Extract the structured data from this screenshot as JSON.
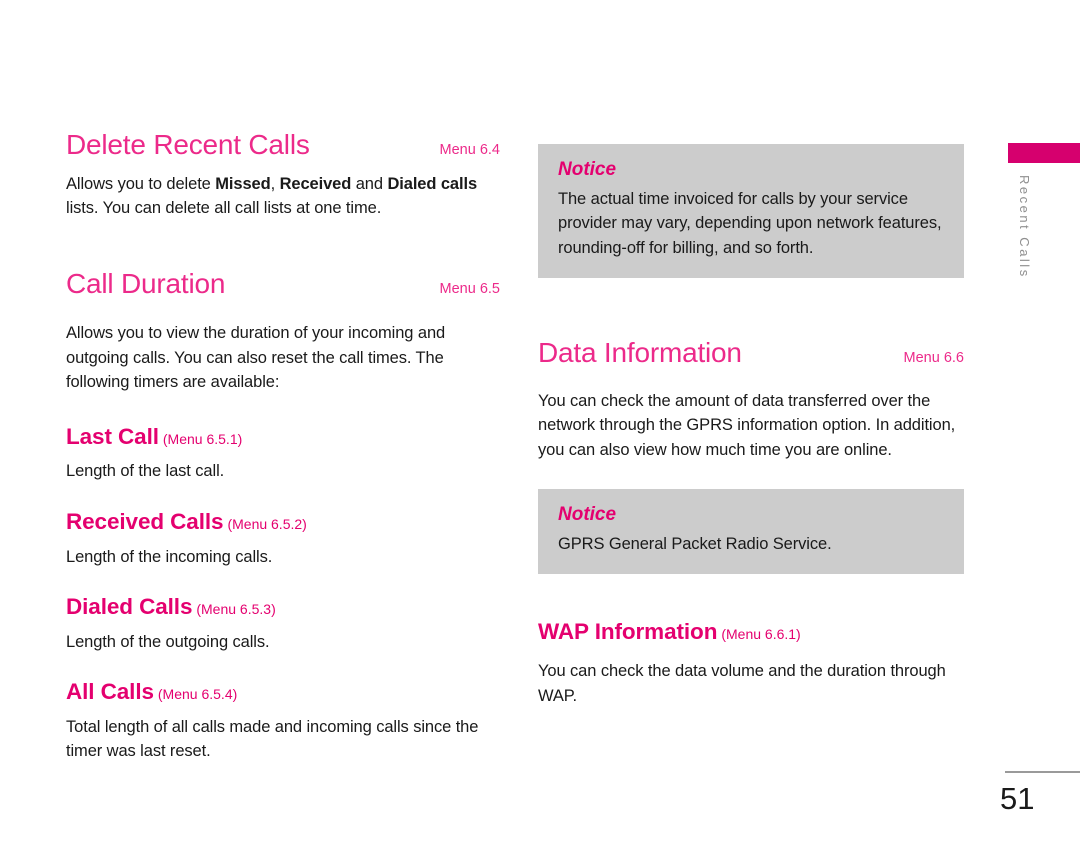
{
  "page": {
    "number": "51",
    "tab_label": "Recent Calls",
    "accent_heading": "#ec2a8a",
    "accent_subheading": "#e4006f",
    "tab_color": "#d6006e",
    "notice_bg": "#cccccc"
  },
  "left_column": {
    "sections": [
      {
        "title": "Delete Recent Calls",
        "menu": "Menu 6.4",
        "paragraph_parts": [
          {
            "text": "Allows you to delete ",
            "bold": false
          },
          {
            "text": "Missed",
            "bold": true
          },
          {
            "text": ", ",
            "bold": false
          },
          {
            "text": "Received",
            "bold": true
          },
          {
            "text": " and ",
            "bold": false
          },
          {
            "text": "Dialed calls",
            "bold": true
          },
          {
            "text": " lists. You can delete all call lists at one time.",
            "bold": false
          }
        ]
      },
      {
        "title": "Call Duration",
        "menu": "Menu 6.5",
        "paragraph": "Allows you to view the duration of your incoming and outgoing calls. You can also reset the call times. The following timers are available:"
      }
    ],
    "subsections": [
      {
        "title": "Last Call",
        "menu": "(Menu 6.5.1)",
        "body": "Length of the last call."
      },
      {
        "title": "Received Calls",
        "menu": "(Menu 6.5.2)",
        "body": "Length of the incoming calls."
      },
      {
        "title": "Dialed Calls",
        "menu": "(Menu 6.5.3)",
        "body": "Length of the outgoing calls."
      },
      {
        "title": "All Calls",
        "menu": "(Menu 6.5.4)",
        "body": "Total length of all calls made and incoming calls since the timer was last reset."
      }
    ]
  },
  "right_column": {
    "notice_top": {
      "title": "Notice",
      "body": "The actual time invoiced for calls by your service provider may vary, depending upon network features, rounding-off for billing, and so forth."
    },
    "section": {
      "title": "Data Information",
      "menu": "Menu 6.6",
      "paragraph": "You can check the amount of data transferred over the network through the GPRS information option. In addition, you can also view how much time you are online."
    },
    "notice_bottom": {
      "title": "Notice",
      "body": "GPRS General Packet Radio Service."
    },
    "subsection": {
      "title": "WAP Information",
      "menu": "(Menu 6.6.1)",
      "body": "You can check the data volume and the duration through WAP."
    }
  }
}
